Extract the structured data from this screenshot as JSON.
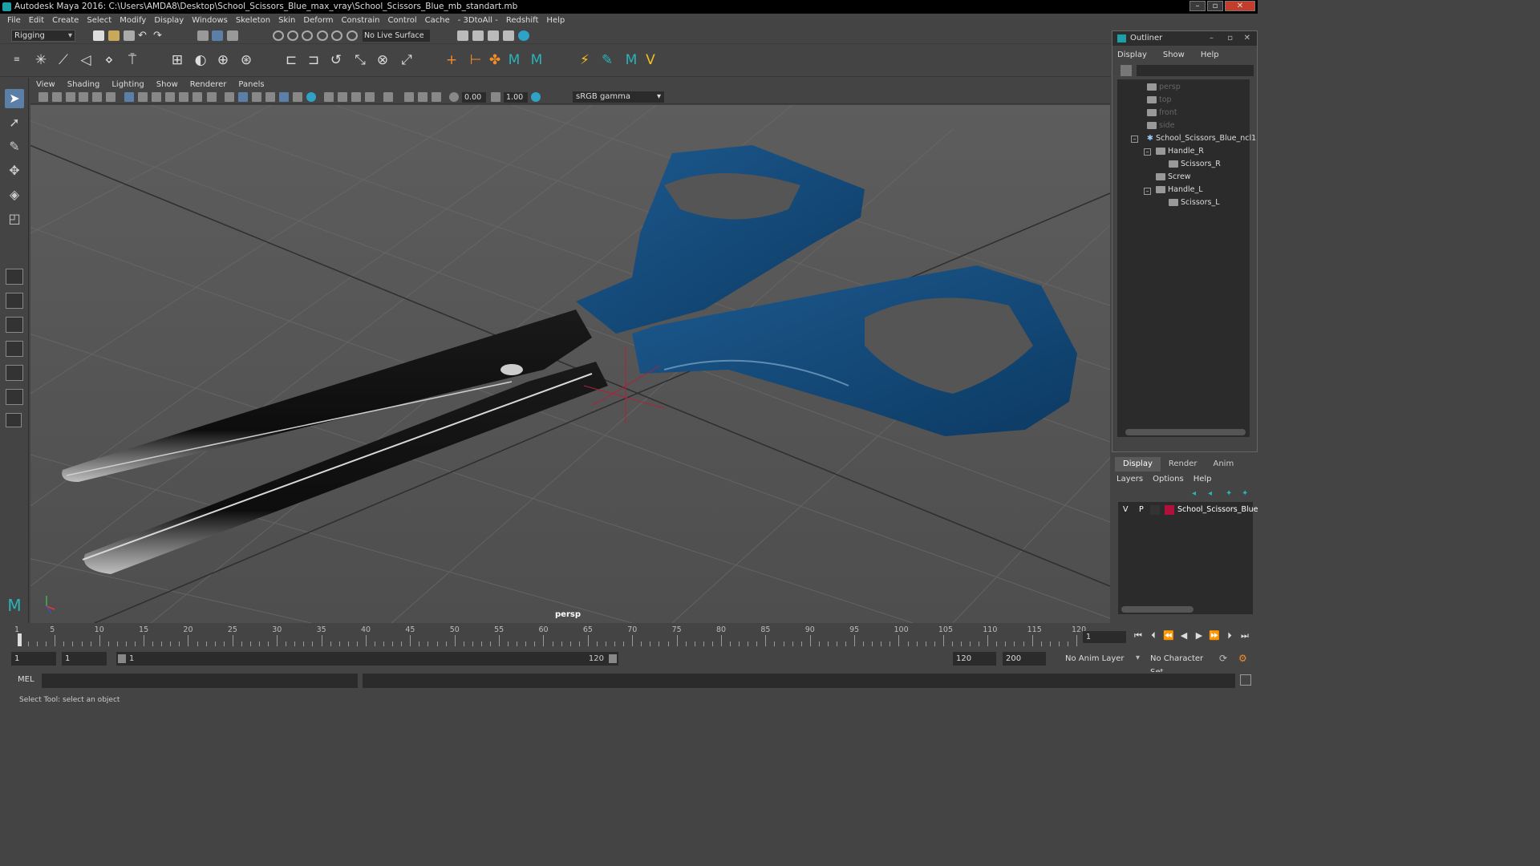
{
  "title": "Autodesk Maya 2016: C:\\Users\\AMDA8\\Desktop\\School_Scissors_Blue_max_vray\\School_Scissors_Blue_mb_standart.mb",
  "menus": [
    "File",
    "Edit",
    "Create",
    "Select",
    "Modify",
    "Display",
    "Windows",
    "Skeleton",
    "Skin",
    "Deform",
    "Constrain",
    "Control",
    "Cache",
    "- 3DtoAll -",
    "Redshift",
    "Help"
  ],
  "status": {
    "mode": "Rigging",
    "live_surface": "No Live Surface"
  },
  "viewport": {
    "menus": [
      "View",
      "Shading",
      "Lighting",
      "Show",
      "Renderer",
      "Panels"
    ],
    "exposure": "0.00",
    "gamma": "1.00",
    "color_space": "sRGB gamma",
    "camera": "persp"
  },
  "outliner": {
    "title": "Outliner",
    "menus": [
      "Display",
      "Show",
      "Help"
    ],
    "items": [
      {
        "label": "persp"
      },
      {
        "label": "top"
      },
      {
        "label": "front"
      },
      {
        "label": "side"
      },
      {
        "label": "School_Scissors_Blue_ncl1"
      },
      {
        "label": "Handle_R"
      },
      {
        "label": "Scissors_R"
      },
      {
        "label": "Screw"
      },
      {
        "label": "Handle_L"
      },
      {
        "label": "Scissors_L"
      }
    ]
  },
  "layers": {
    "tabs": [
      "Display",
      "Render",
      "Anim"
    ],
    "menus": [
      "Layers",
      "Options",
      "Help"
    ],
    "row": {
      "v": "V",
      "p": "P",
      "name": "School_Scissors_Blue",
      "color": "#b0103a"
    }
  },
  "timeline": {
    "ticks": [
      "1",
      "5",
      "10",
      "15",
      "20",
      "25",
      "30",
      "35",
      "40",
      "45",
      "50",
      "55",
      "60",
      "65",
      "70",
      "75",
      "80",
      "85",
      "90",
      "95",
      "100",
      "105",
      "110",
      "115",
      "120"
    ],
    "current_frame": "1"
  },
  "range": {
    "start": "1",
    "start2": "1",
    "range_start": "1",
    "range_end": "120",
    "end": "120",
    "max_end": "200",
    "anim_layer": "No Anim Layer",
    "char_set": "No Character Set"
  },
  "cmd": {
    "lang": "MEL"
  },
  "help_line": "Select Tool: select an object"
}
